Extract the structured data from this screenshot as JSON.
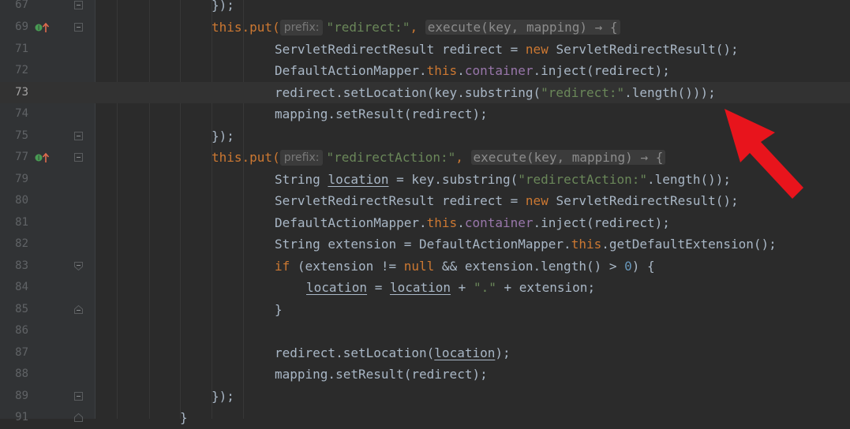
{
  "editor": {
    "lines": [
      {
        "number": "67",
        "text": "});"
      },
      {
        "number": "69",
        "hint_label": "prefix:",
        "pre": "this.put(",
        "string": "\"redirect:\"",
        "lambda": "execute(key, mapping) → {"
      },
      {
        "number": "71",
        "type": "ServletRedirectResult",
        "var": "redirect",
        "op": "=",
        "new_kw": "new",
        "ctor": "ServletRedirectResult();"
      },
      {
        "number": "72",
        "cls": "DefaultActionMapper.",
        "this_kw": "this",
        "dot": ".",
        "field": "container",
        "rest": ".inject(redirect);"
      },
      {
        "number": "73",
        "a": "redirect.setLocation(key.substring(",
        "string": "\"redirect:\"",
        "b": ".length()));"
      },
      {
        "number": "74",
        "text": "mapping.setResult(redirect);"
      },
      {
        "number": "75",
        "text": "});"
      },
      {
        "number": "77",
        "hint_label": "prefix:",
        "pre": "this.put(",
        "string": "\"redirectAction:\"",
        "lambda": "execute(key, mapping) → {"
      },
      {
        "number": "79",
        "type": "String",
        "var": "location",
        "mid": "= key.substring(",
        "string": "\"redirectAction:\"",
        "rest": ".length());"
      },
      {
        "number": "80",
        "type": "ServletRedirectResult",
        "var": "redirect",
        "op": "=",
        "new_kw": "new",
        "ctor": "ServletRedirectResult();"
      },
      {
        "number": "81",
        "cls": "DefaultActionMapper.",
        "this_kw": "this",
        "dot": ".",
        "field": "container",
        "rest": ".inject(redirect);"
      },
      {
        "number": "82",
        "a": "String extension = DefaultActionMapper.",
        "this_kw": "this",
        "b": ".getDefaultExtension();"
      },
      {
        "number": "83",
        "if_kw": "if",
        "a": " (extension != ",
        "null_kw": "null",
        "b": " && extension.length() > ",
        "num": "0",
        "c": ") {"
      },
      {
        "number": "84",
        "v1": "location",
        "eq": " = ",
        "v2": "location",
        "plus": " + ",
        "string": "\".\"",
        "tail": " + extension;"
      },
      {
        "number": "85",
        "text": "}"
      },
      {
        "number": "86",
        "text": ""
      },
      {
        "number": "87",
        "a": "redirect.setLocation(",
        "v": "location",
        "b": ");"
      },
      {
        "number": "88",
        "text": "mapping.setResult(redirect);"
      },
      {
        "number": "89",
        "text": "});"
      },
      {
        "number": "91",
        "text": "}"
      }
    ]
  },
  "colors": {
    "background": "#2b2b2b",
    "keyword": "#cc7832",
    "string": "#6a8759",
    "field": "#9876aa",
    "number": "#6897bb",
    "text": "#a9b7c6",
    "annotation_arrow": "#e8141c"
  },
  "icons": {
    "override_marker": "override-implements-icon",
    "fold": "fold-icon",
    "arrow": "red-arrow-annotation-icon"
  }
}
